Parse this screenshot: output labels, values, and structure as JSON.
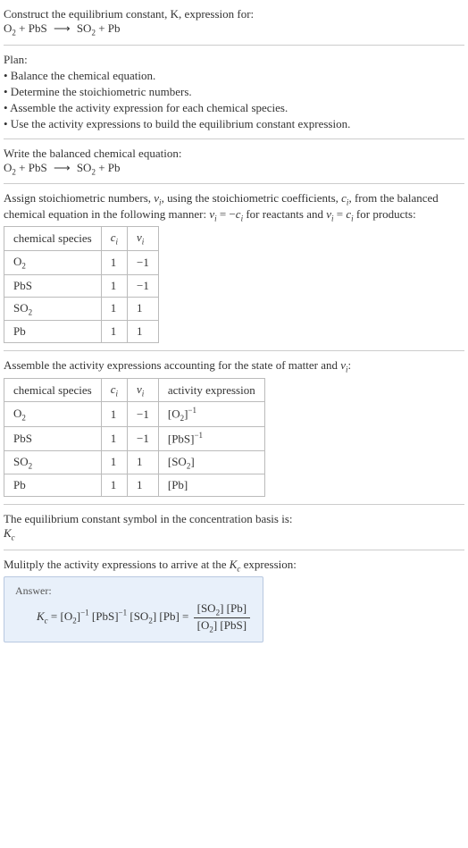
{
  "intro": {
    "line1": "Construct the equilibrium constant, K, expression for:",
    "eq_html": "O<span class='sub'>2</span> + PbS <span class='arrow'>⟶</span> SO<span class='sub'>2</span> + Pb"
  },
  "plan": {
    "title": "Plan:",
    "items": [
      "• Balance the chemical equation.",
      "• Determine the stoichiometric numbers.",
      "• Assemble the activity expression for each chemical species.",
      "• Use the activity expressions to build the equilibrium constant expression."
    ]
  },
  "balanced": {
    "title": "Write the balanced chemical equation:",
    "eq_html": "O<span class='sub'>2</span> + PbS <span class='arrow'>⟶</span> SO<span class='sub'>2</span> + Pb"
  },
  "stoich": {
    "text_html": "Assign stoichiometric numbers, <span class='italic'>ν<span class='sub'>i</span></span>, using the stoichiometric coefficients, <span class='italic'>c<span class='sub'>i</span></span>, from the balanced chemical equation in the following manner: <span class='italic'>ν<span class='sub'>i</span></span> = −<span class='italic'>c<span class='sub'>i</span></span> for reactants and <span class='italic'>ν<span class='sub'>i</span></span> = <span class='italic'>c<span class='sub'>i</span></span> for products:",
    "headers": [
      "chemical species",
      "c_i",
      "ν_i"
    ],
    "rows": [
      {
        "species_html": "O<span class='sub'>2</span>",
        "ci": "1",
        "vi": "−1"
      },
      {
        "species_html": "PbS",
        "ci": "1",
        "vi": "−1"
      },
      {
        "species_html": "SO<span class='sub'>2</span>",
        "ci": "1",
        "vi": "1"
      },
      {
        "species_html": "Pb",
        "ci": "1",
        "vi": "1"
      }
    ]
  },
  "activity": {
    "title_html": "Assemble the activity expressions accounting for the state of matter and <span class='italic'>ν<span class='sub'>i</span></span>:",
    "headers": [
      "chemical species",
      "c_i",
      "ν_i",
      "activity expression"
    ],
    "rows": [
      {
        "species_html": "O<span class='sub'>2</span>",
        "ci": "1",
        "vi": "−1",
        "expr_html": "[O<span class='sub'>2</span>]<span class='sup'>−1</span>"
      },
      {
        "species_html": "PbS",
        "ci": "1",
        "vi": "−1",
        "expr_html": "[PbS]<span class='sup'>−1</span>"
      },
      {
        "species_html": "SO<span class='sub'>2</span>",
        "ci": "1",
        "vi": "1",
        "expr_html": "[SO<span class='sub'>2</span>]"
      },
      {
        "species_html": "Pb",
        "ci": "1",
        "vi": "1",
        "expr_html": "[Pb]"
      }
    ]
  },
  "kc_basis": {
    "line1": "The equilibrium constant symbol in the concentration basis is:",
    "symbol_html": "<span class='italic'>K<span class='sub'>c</span></span>"
  },
  "multiply": {
    "text_html": "Mulitply the activity expressions to arrive at the <span class='italic'>K<span class='sub'>c</span></span> expression:"
  },
  "answer": {
    "label": "Answer:",
    "lhs_html": "<span class='italic'>K<span class='sub'>c</span></span> = [O<span class='sub'>2</span>]<span class='sup'>−1</span> [PbS]<span class='sup'>−1</span> [SO<span class='sub'>2</span>] [Pb] = ",
    "frac_num_html": "[SO<span class='sub'>2</span>] [Pb]",
    "frac_den_html": "[O<span class='sub'>2</span>] [PbS]"
  },
  "chart_data": {
    "type": "table",
    "tables": [
      {
        "title": "Stoichiometric numbers",
        "columns": [
          "chemical species",
          "c_i",
          "ν_i"
        ],
        "rows": [
          [
            "O2",
            1,
            -1
          ],
          [
            "PbS",
            1,
            -1
          ],
          [
            "SO2",
            1,
            1
          ],
          [
            "Pb",
            1,
            1
          ]
        ]
      },
      {
        "title": "Activity expressions",
        "columns": [
          "chemical species",
          "c_i",
          "ν_i",
          "activity expression"
        ],
        "rows": [
          [
            "O2",
            1,
            -1,
            "[O2]^-1"
          ],
          [
            "PbS",
            1,
            -1,
            "[PbS]^-1"
          ],
          [
            "SO2",
            1,
            1,
            "[SO2]"
          ],
          [
            "Pb",
            1,
            1,
            "[Pb]"
          ]
        ]
      }
    ]
  }
}
